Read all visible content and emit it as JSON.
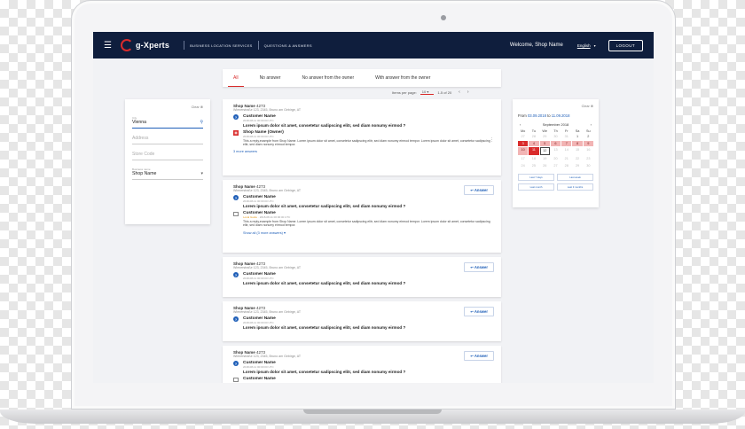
{
  "app": {
    "brand": "g-Xperts",
    "nav": [
      "BUSINESS LOCATION SERVICES",
      "QUESTIONS & ANSWERS"
    ],
    "welcome": "Welcome, Shop Name",
    "language": "English",
    "logout": "LOGOUT"
  },
  "tabs": [
    {
      "label": "All",
      "active": true
    },
    {
      "label": "No answer"
    },
    {
      "label": "No answer from the owner"
    },
    {
      "label": "With answer from the owner"
    }
  ],
  "pager": {
    "items_label": "Items per page:",
    "per_page": "10",
    "range": "1-5 of 20"
  },
  "filters": {
    "clear": "Clear",
    "city_label": "City",
    "city_value": "Vienna",
    "address_placeholder": "Address",
    "store_code_placeholder": "Store Code",
    "business_label": "Business name",
    "business_value": "Shop Name"
  },
  "cards": [
    {
      "shop": "Shop Name",
      "id": "4273",
      "address": "Wienerstraße 123, 2345, Bruno am Gebirge, AT",
      "question_author": "Customer Name",
      "question_date": "2018-08-11 00:00:00 UTC",
      "question": "Lorem ipsum dolor sit amet, consetetur sadipscing elitr, sed diam nonumy eirmod ?",
      "reply_author": "Shop Name (Owner)",
      "reply_date": "2018-08-11 00:00:00 UTC",
      "reply": "This a reply,example from Shop Name. Lorem ipsum dolor sit amet, consetetur sadipscing elitr, sed diam nonumy eirmod tempor. Lorem ipsum dolor sit amet, consetetur sadipscing elitr, sed diam nonumy eirmod tempor.",
      "more": "3 more answers"
    },
    {
      "shop": "Shop Name",
      "id": "4273",
      "address": "Wienerstraße 123, 2345, Bruno am Gebirge, AT",
      "answer": "Answer",
      "question_author": "Customer Name",
      "question_date": "2018-08-11 00:00:00 UTC",
      "question": "Lorem ipsum dolor sit amet, consetetur sadipscing elitr, sed diam nonumy eirmod ?",
      "reply_author": "Customer Name",
      "reply_tag": "Local Guide",
      "reply_date": "2018-08-11 00:00:00 UTC",
      "reply": "This a reply,example from Shop Name. Lorem ipsum dolor sit amet, consetetur sadipscing elitr, sed diam nonumy eirmod tempor. Lorem ipsum dolor sit amet, consetetur sadipscing elitr, sed diam nonumy eirmod tempor.",
      "more": "Show all (3 more answers)"
    },
    {
      "shop": "Shop Name",
      "id": "4273",
      "address": "Wienerstraße 123, 2345, Bruno am Gebirge, AT",
      "answer": "Answer",
      "question_author": "Customer Name",
      "question_date": "2018-08-11 00:00:00 UTC",
      "question": "Lorem ipsum dolor sit amet, consetetur sadipscing elitr, sed diam nonumy eirmod ?"
    },
    {
      "shop": "Shop Name",
      "id": "4273",
      "address": "Wienerstraße 123, 2345, Bruno am Gebirge, AT",
      "answer": "Answer",
      "question_author": "Customer Name",
      "question_date": "2018-08-11 00:00:00 UTC",
      "question": "Lorem ipsum dolor sit amet, consetetur sadipscing elitr, sed diam nonumy eirmod ?"
    },
    {
      "shop": "Shop Name",
      "id": "4273",
      "address": "Wienerstraße 123, 2345, Bruno am Gebirge, AT",
      "answer": "Answer",
      "question_author": "Customer Name",
      "question_date": "2018-08-11 00:00:00 UTC",
      "question": "Lorem ipsum dolor sit amet, consetetur sadipscing elitr, sed diam nonumy eirmod ?",
      "reply_author": "Customer Name"
    }
  ],
  "calendar": {
    "clear": "Clear",
    "from_label": "From",
    "from": "03.09.2018",
    "to_label": "to",
    "to": "11.09.2018",
    "month": "September 2018",
    "weekdays": [
      "Mo",
      "Tu",
      "We",
      "Th",
      "Fr",
      "Sa",
      "Su"
    ],
    "days": [
      "27",
      "28",
      "29",
      "30",
      "31",
      "1",
      "2",
      "3",
      "4",
      "5",
      "6",
      "7",
      "8",
      "9",
      "10",
      "11",
      "12",
      "13",
      "14",
      "15",
      "16",
      "17",
      "18",
      "19",
      "20",
      "21",
      "22",
      "23",
      "24",
      "25",
      "26",
      "27",
      "28",
      "29",
      "30"
    ],
    "buttons": [
      "Last 7 days",
      "Last week",
      "Last month",
      "Last 3 months"
    ]
  },
  "colors": {
    "brand_red": "#d92b2b",
    "navy": "#0f1e3d",
    "link_blue": "#1f5fb8"
  }
}
